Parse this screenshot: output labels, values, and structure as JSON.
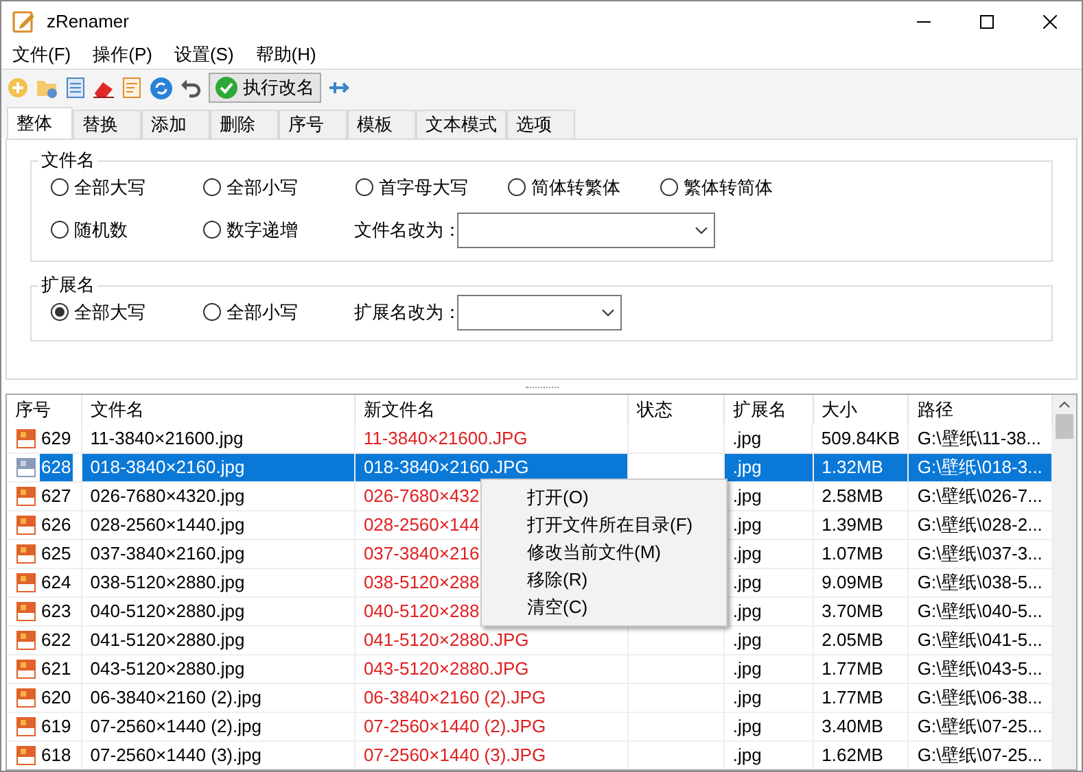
{
  "window": {
    "title": "zRenamer"
  },
  "menu": [
    "文件(F)",
    "操作(P)",
    "设置(S)",
    "帮助(H)"
  ],
  "toolbar": {
    "execute_button": "执行改名"
  },
  "tabs": [
    {
      "label": "整体",
      "selected": true
    },
    {
      "label": "替换",
      "selected": false
    },
    {
      "label": "添加",
      "selected": false
    },
    {
      "label": "删除",
      "selected": false
    },
    {
      "label": "序号",
      "selected": false
    },
    {
      "label": "模板",
      "selected": false
    },
    {
      "label": "文本模式",
      "selected": false
    },
    {
      "label": "选项",
      "selected": false
    }
  ],
  "filename_group": {
    "title": "文件名",
    "options": [
      {
        "label": "全部大写",
        "selected": false
      },
      {
        "label": "全部小写",
        "selected": false
      },
      {
        "label": "首字母大写",
        "selected": false
      },
      {
        "label": "简体转繁体",
        "selected": false
      },
      {
        "label": "繁体转简体",
        "selected": false
      },
      {
        "label": "随机数",
        "selected": false
      },
      {
        "label": "数字递增",
        "selected": false
      }
    ],
    "rename_label": "文件名改为："
  },
  "extension_group": {
    "title": "扩展名",
    "options": [
      {
        "label": "全部大写",
        "selected": true
      },
      {
        "label": "全部小写",
        "selected": false
      }
    ],
    "rename_label": "扩展名改为："
  },
  "table": {
    "columns": [
      "序号",
      "文件名",
      "新文件名",
      "状态",
      "扩展名",
      "大小",
      "路径"
    ],
    "rows": [
      {
        "number": "629",
        "name": "11-3840×21600.jpg",
        "new_name": "11-3840×21600.JPG",
        "ext": ".jpg",
        "size": "509.84KB",
        "path": "G:\\壁纸\\11-38...",
        "selected": false
      },
      {
        "number": "628",
        "name": "018-3840×2160.jpg",
        "new_name": "018-3840×2160.JPG",
        "ext": ".jpg",
        "size": "1.32MB",
        "path": "G:\\壁纸\\018-3...",
        "selected": true
      },
      {
        "number": "627",
        "name": "026-7680×4320.jpg",
        "new_name": "026-7680×432",
        "ext": ".jpg",
        "size": "2.58MB",
        "path": "G:\\壁纸\\026-7...",
        "selected": false
      },
      {
        "number": "626",
        "name": "028-2560×1440.jpg",
        "new_name": "028-2560×144",
        "ext": ".jpg",
        "size": "1.39MB",
        "path": "G:\\壁纸\\028-2...",
        "selected": false
      },
      {
        "number": "625",
        "name": "037-3840×2160.jpg",
        "new_name": "037-3840×216",
        "ext": ".jpg",
        "size": "1.07MB",
        "path": "G:\\壁纸\\037-3...",
        "selected": false
      },
      {
        "number": "624",
        "name": "038-5120×2880.jpg",
        "new_name": "038-5120×288",
        "ext": ".jpg",
        "size": "9.09MB",
        "path": "G:\\壁纸\\038-5...",
        "selected": false
      },
      {
        "number": "623",
        "name": "040-5120×2880.jpg",
        "new_name": "040-5120×288",
        "ext": ".jpg",
        "size": "3.70MB",
        "path": "G:\\壁纸\\040-5...",
        "selected": false
      },
      {
        "number": "622",
        "name": "041-5120×2880.jpg",
        "new_name": "041-5120×2880.JPG",
        "ext": ".jpg",
        "size": "2.05MB",
        "path": "G:\\壁纸\\041-5...",
        "selected": false
      },
      {
        "number": "621",
        "name": "043-5120×2880.jpg",
        "new_name": "043-5120×2880.JPG",
        "ext": ".jpg",
        "size": "1.77MB",
        "path": "G:\\壁纸\\043-5...",
        "selected": false
      },
      {
        "number": "620",
        "name": "06-3840×2160 (2).jpg",
        "new_name": "06-3840×2160 (2).JPG",
        "ext": ".jpg",
        "size": "1.77MB",
        "path": "G:\\壁纸\\06-38...",
        "selected": false
      },
      {
        "number": "619",
        "name": "07-2560×1440 (2).jpg",
        "new_name": "07-2560×1440 (2).JPG",
        "ext": ".jpg",
        "size": "3.40MB",
        "path": "G:\\壁纸\\07-25...",
        "selected": false
      },
      {
        "number": "618",
        "name": "07-2560×1440 (3).jpg",
        "new_name": "07-2560×1440 (3).JPG",
        "ext": ".jpg",
        "size": "1.62MB",
        "path": "G:\\壁纸\\07-25...",
        "selected": false
      }
    ]
  },
  "context_menu": [
    "打开(O)",
    "打开文件所在目录(F)",
    "修改当前文件(M)",
    "移除(R)",
    "清空(C)"
  ]
}
